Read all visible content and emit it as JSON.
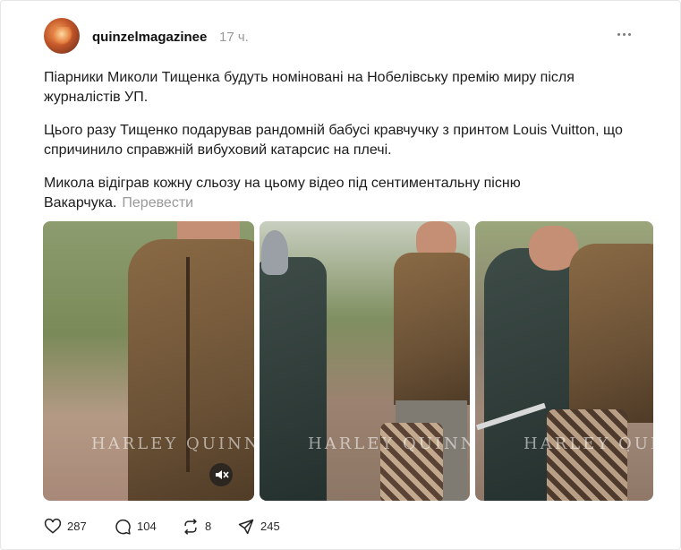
{
  "post": {
    "username": "quinzelmagazinee",
    "time": "17 ч.",
    "paragraphs": [
      "Піарники Миколи Тищенка будуть номіновані на Нобелівську премію миру після журналістів УП.",
      "Цього разу Тищенко подарував рандомній бабусі кравчучку з принтом Louis Vuitton, що спричинило справжній вибуховий катарсис на плечі.",
      "Микола відіграв кожну сльозу на цьому відео під сентиментальну пісню Вакарчука."
    ],
    "translate_label": "Перевести",
    "watermark": "HARLEY QUINN",
    "actions": {
      "likes": "287",
      "comments": "104",
      "reposts": "8",
      "shares": "245"
    }
  },
  "icons": {
    "more": "more-icon",
    "like": "heart-icon",
    "comment": "comment-icon",
    "repost": "repost-icon",
    "share": "share-icon",
    "mute": "muted-speaker-icon"
  }
}
